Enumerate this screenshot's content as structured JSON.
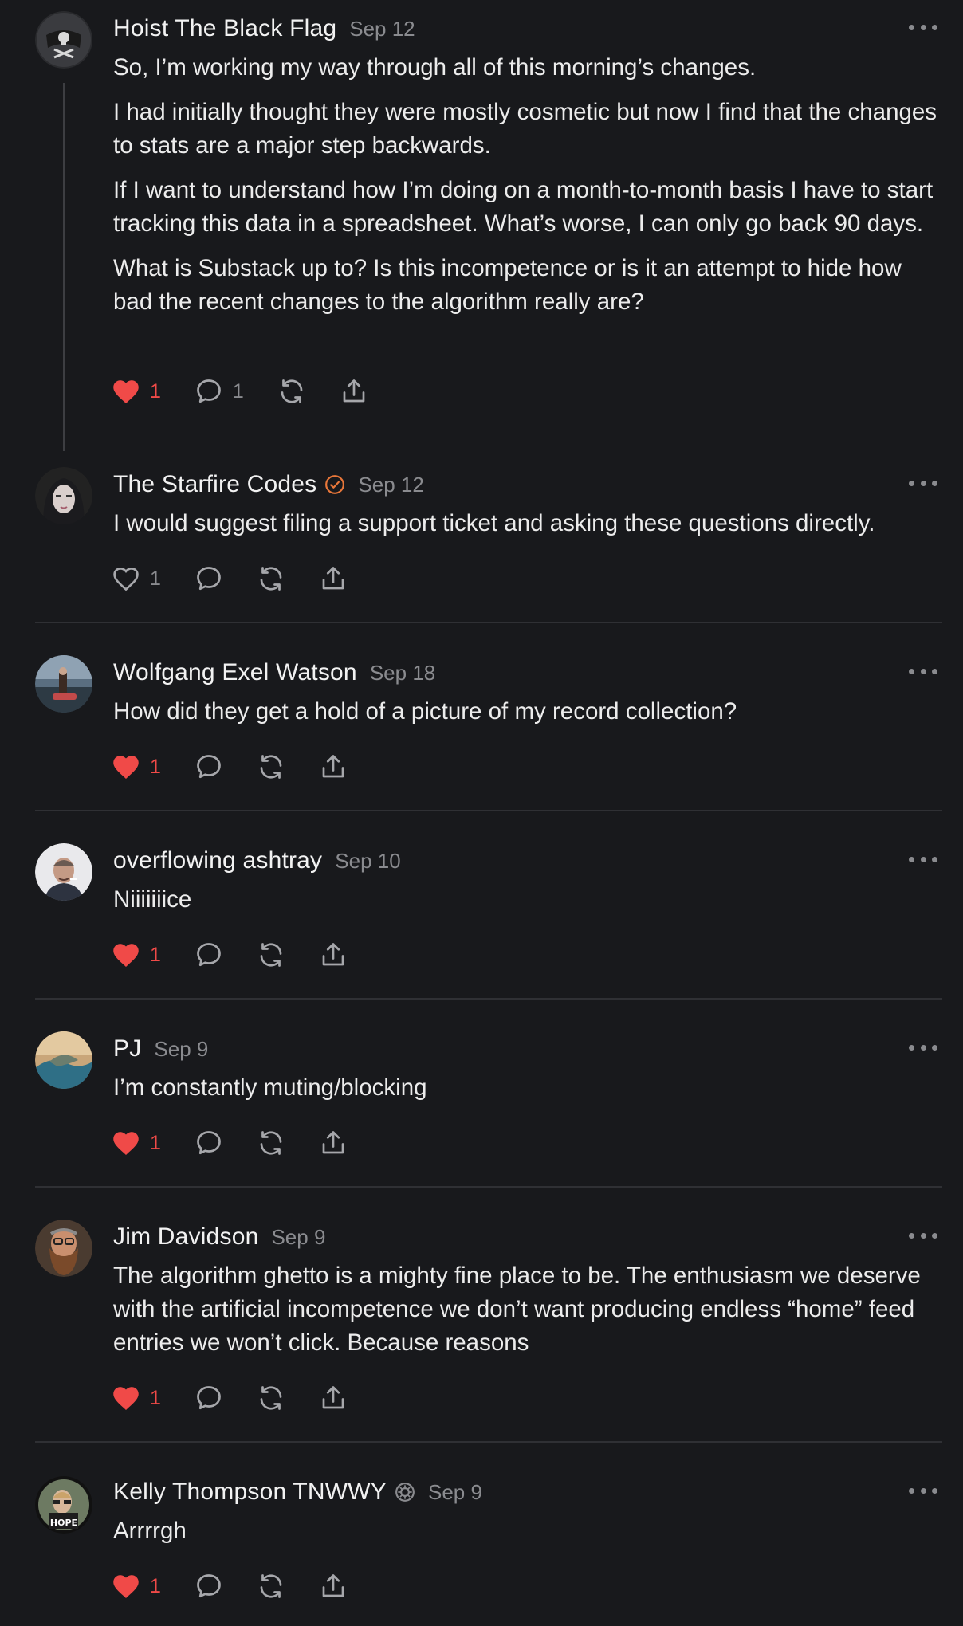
{
  "comments": [
    {
      "author": "Hoist The Black Flag",
      "date": "Sep 12",
      "paragraphs": [
        "So, I’m working my way through all of this morning’s changes.",
        "I had initially thought they were mostly cosmetic but now I find that the changes to stats are a major step backwards.",
        "If I want to understand how I’m doing on a month-to-month basis I have to start tracking this data in a spreadsheet. What’s worse, I can only go back 90 days.",
        "What is Substack up to? Is this incompetence or is it an attempt to hide how bad the recent changes to the algorithm really are?"
      ],
      "likes": "1",
      "liked": true,
      "replies": "1"
    },
    {
      "author": "The Starfire Codes",
      "date": "Sep 12",
      "paragraphs": [
        "I would suggest filing a support ticket and asking these questions directly."
      ],
      "likes": "1",
      "liked": false
    },
    {
      "author": "Wolfgang Exel Watson",
      "date": "Sep 18",
      "paragraphs": [
        "How did they get a hold of a picture of my record collection?"
      ],
      "likes": "1",
      "liked": true
    },
    {
      "author": "overflowing ashtray",
      "date": "Sep 10",
      "paragraphs": [
        "Niiiiiiice"
      ],
      "likes": "1",
      "liked": true
    },
    {
      "author": "PJ",
      "date": "Sep 9",
      "paragraphs": [
        "I’m constantly muting/blocking"
      ],
      "likes": "1",
      "liked": true
    },
    {
      "author": "Jim Davidson",
      "date": "Sep 9",
      "paragraphs": [
        "The algorithm ghetto is a mighty fine place to be. The enthusiasm we deserve with the artificial incompetence we don’t want producing endless “home” feed entries we won’t click. Because reasons"
      ],
      "likes": "1",
      "liked": true
    },
    {
      "author": "Kelly Thompson TNWWY",
      "date": "Sep 9",
      "paragraphs": [
        "Arrrrgh"
      ],
      "likes": "1",
      "liked": true
    }
  ],
  "colors": {
    "background": "#18191c",
    "like_active": "#f04a48",
    "verified_badge": "#e8773a",
    "muted_text": "#8a8b8f"
  }
}
